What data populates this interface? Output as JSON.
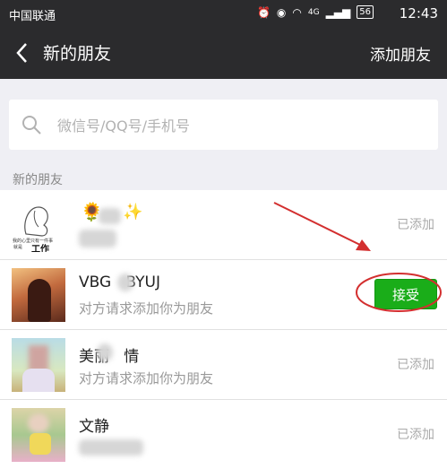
{
  "status_bar": {
    "carrier": "中国联通",
    "time": "12:43",
    "battery": "56",
    "signal_label": "4G"
  },
  "nav": {
    "title": "新的朋友",
    "action": "添加朋友"
  },
  "search": {
    "placeholder": "微信号/QQ号/手机号"
  },
  "section_title": "新的朋友",
  "requests": [
    {
      "name": "",
      "subtitle": "",
      "status": "已添加",
      "avatar_text": [
        "我的心里只有一件事",
        "就是",
        "工作"
      ]
    },
    {
      "name": "VBG   BYUJ",
      "subtitle": "对方请求添加你为朋友",
      "action": "接受"
    },
    {
      "name": "美丽   情",
      "subtitle": "对方请求添加你为朋友",
      "status": "已添加"
    },
    {
      "name": "文静",
      "subtitle": "",
      "status": "已添加"
    }
  ],
  "colors": {
    "header_bg": "#2b2b2d",
    "accept_green": "#1aad19",
    "annotation_red": "#d32f2f"
  }
}
